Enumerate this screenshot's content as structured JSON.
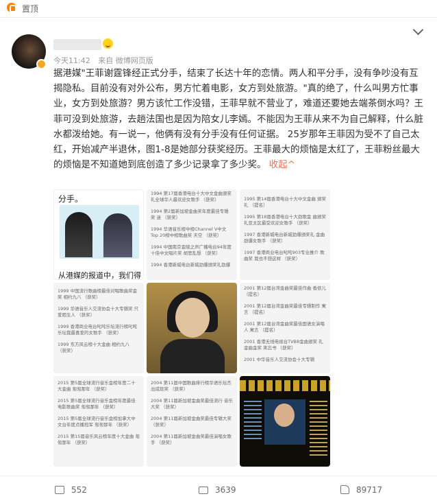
{
  "topbar": {
    "pin_label": "置顶"
  },
  "post": {
    "time": "今天11:42",
    "source": "来自 微博网页版",
    "text": "据港媒\"王菲谢霆锋经正式分手，结束了长达十年的恋情。两人和平分手，没有争吵没有互揭隐私。目前没有对外公布，男方忙着电影，女方到处旅游。\"真的绝了，什么叫男方忙事业，女方到处旅游？男方该忙工作没错，王菲早就不营业了，难道还要她去端茶倒水吗？王菲可没到处旅游，去趟法国也是因为陪女儿李嫣。不能因为王菲从来不为自己解释，什么脏水都泼给她。有一说一，他俩有没有分手没有任何证据。 25岁那年王菲因为受不了自己太红，开始减产半退休，图1-8是她部分获奖经历。王菲最大的烦恼是太红了，王菲粉丝最大的烦恼是不知道她到底创造了多少记录拿了多少奖。",
    "fold_label": "收起^"
  },
  "images": {
    "img1": {
      "top": "分手。",
      "bottom": "从港媒的报道中，我们得"
    },
    "img2": [
      "1994 第17届香港电台十大中文金曲颁奖 礼全球华人最欢迎女歌手 （获奖）",
      "1994 第2届新加坡金曲奖年度最佳专辑 奖 迷 （获奖）",
      "1994 华语音乐榜中榜Channel V中文Top 20榜中榜歌曲奖 天空 （获奖）",
      "1994 中国南京金陵之声广播电台94年度 十佳中文唱片奖 胡思乱想 （获奖）",
      "1994 香港新城电台新城劲爆颁奖礼劲爆"
    ],
    "img3": [
      "1995 第14届香港电台十大中文金曲 颁奖礼 （提名）",
      "1995 第18届香港电台十大劲歌金 曲颁奖礼亚太区最受欢迎女歌手 （获奖）",
      "1997 香港新城电台新城劲爆颁奖礼 金曲 劲爆女歌手 （获奖）",
      "1997 香港商业电台叱咤903专业推介 歌曲奖 我也不想这样 （获奖）"
    ],
    "img4": [
      "1999 中国流行歌曲榜最佳对唱歌曲奖金 奖 相约九八 （获奖）",
      "1999 华语音乐人交流协会十大专辑奖 只 爱陌生人 （获奖）",
      "1999 香港商业电台叱咤乐坛流行榜叱咤 乐坛我最喜爱的女歌手 （获奖）",
      "1999 东方风云榜十大金曲 相约九八 （获奖）"
    ],
    "img6": [
      "2001 第12届台湾金曲奖最佳作曲 香侬儿 （提名）",
      "2001 第12届台湾金曲奖最佳专辑制作 寓 言 （提名）",
      "2001 第12届台湾金曲奖最佳国语女演唱 人 寓言 （提名）",
      "2001 香港无线电视台TVB8金曲颁奖 礼金曲金奖 笑忘书 （获奖）",
      "2001 中华音乐人交流协会十大专辑"
    ],
    "img7": [
      "2015 第5届全球流行音乐金榜年度二十 大金曲 匆匆那年 （获奖）",
      "2015 第5届全球流行音乐金榜年度最佳 电影歌曲奖 匆匆那年 （获奖）",
      "2015 第5届全球流行音乐金榜加拿大中 文台年度点播冠军 匆匆那年 （获奖）",
      "2015 第15届音乐风云榜年度十大金曲 匆 匆那年 （获奖）"
    ],
    "img8": [
      "2004 第11届中国歌曲排行榜华语乐坛杰 出成就奖 （获奖）",
      "2004 第11届新加坡金曲奖最佳流行 音乐大奖 （获奖）",
      "2004 第11届新加坡金曲奖最佳专辑大奖 （获奖）",
      "2004 第11届新加坡金曲奖最佳演唱女歌 手 （获奖）"
    ]
  },
  "actions": {
    "shares": "552",
    "comments": "3639",
    "likes": "89717"
  }
}
